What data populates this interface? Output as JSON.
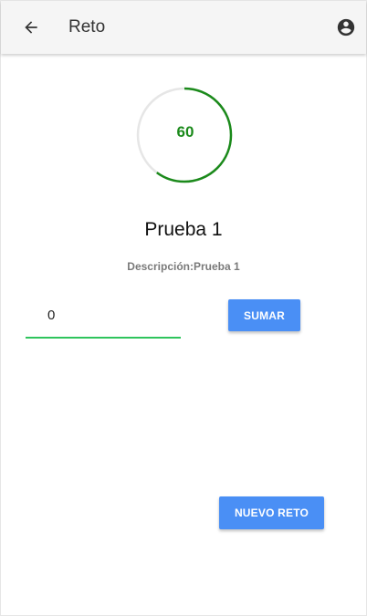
{
  "appbar": {
    "title": "Reto",
    "back_icon": "arrow-left-icon",
    "account_icon": "account-circle-icon"
  },
  "progress": {
    "value": "60",
    "fraction": 0.6,
    "color": "#1b8a1b",
    "track_color": "#e6e6e6"
  },
  "challenge": {
    "name": "Prueba 1",
    "description_label": "Descripción:",
    "description_value": "Prueba 1"
  },
  "amount_input": {
    "value": "0",
    "underline_color": "#2fc45c"
  },
  "buttons": {
    "sumar_label": "SUMAR",
    "nuevo_reto_label": "NUEVO RETO",
    "color": "#4a8ff5"
  }
}
